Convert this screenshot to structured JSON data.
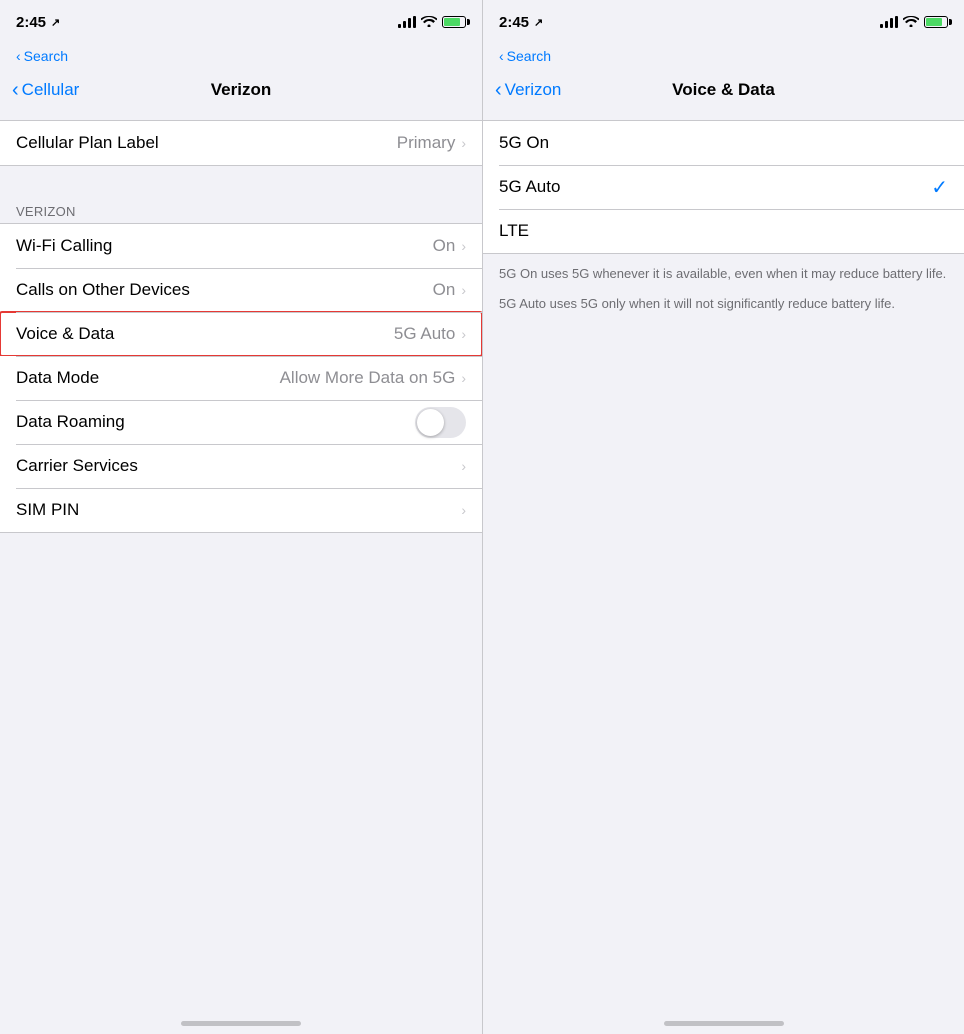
{
  "left": {
    "statusBar": {
      "time": "2:45",
      "locationArrow": "▲"
    },
    "subNav": {
      "backLabel": "Search"
    },
    "navBar": {
      "backLabel": "Cellular",
      "title": "Verizon"
    },
    "rows": [
      {
        "id": "cellular-plan-label",
        "label": "Cellular Plan Label",
        "value": "Primary",
        "hasChevron": true,
        "isToggle": false,
        "highlighted": false
      }
    ],
    "sectionLabel": "VERIZON",
    "verizonRows": [
      {
        "id": "wifi-calling",
        "label": "Wi-Fi Calling",
        "value": "On",
        "hasChevron": true,
        "isToggle": false,
        "highlighted": false
      },
      {
        "id": "calls-other-devices",
        "label": "Calls on Other Devices",
        "value": "On",
        "hasChevron": true,
        "isToggle": false,
        "highlighted": false
      },
      {
        "id": "voice-data",
        "label": "Voice & Data",
        "value": "5G Auto",
        "hasChevron": true,
        "isToggle": false,
        "highlighted": true
      },
      {
        "id": "data-mode",
        "label": "Data Mode",
        "value": "Allow More Data on 5G",
        "hasChevron": true,
        "isToggle": false,
        "highlighted": false
      },
      {
        "id": "data-roaming",
        "label": "Data Roaming",
        "value": "",
        "hasChevron": false,
        "isToggle": true,
        "toggleOn": false,
        "highlighted": false
      },
      {
        "id": "carrier-services",
        "label": "Carrier Services",
        "value": "",
        "hasChevron": true,
        "isToggle": false,
        "highlighted": false
      },
      {
        "id": "sim-pin",
        "label": "SIM PIN",
        "value": "",
        "hasChevron": true,
        "isToggle": false,
        "highlighted": false
      }
    ]
  },
  "right": {
    "statusBar": {
      "time": "2:45",
      "locationArrow": "▲"
    },
    "subNav": {
      "backLabel": "Search"
    },
    "navBar": {
      "backLabel": "Verizon",
      "title": "Voice & Data"
    },
    "options": [
      {
        "id": "5g-on",
        "label": "5G On",
        "selected": false
      },
      {
        "id": "5g-auto",
        "label": "5G Auto",
        "selected": true
      },
      {
        "id": "lte",
        "label": "LTE",
        "selected": false
      }
    ],
    "descriptions": [
      "5G On uses 5G whenever it is available, even when it may reduce battery life.",
      "5G Auto uses 5G only when it will not significantly reduce battery life."
    ]
  }
}
